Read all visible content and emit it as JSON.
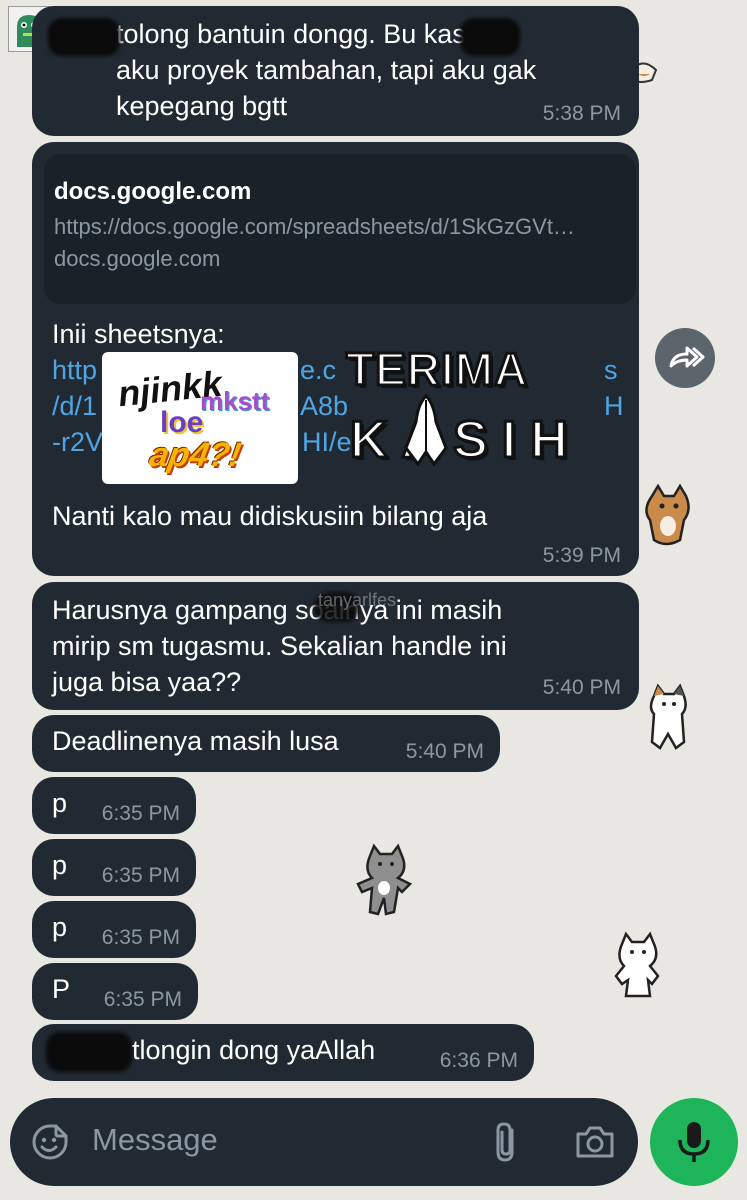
{
  "messages": [
    {
      "text": "tolong bantuin dongg. Bu       kasih\naku proyek tambahan, tapi aku gak\nkepegang bgtt",
      "time": "5:38 PM"
    },
    {
      "text": "Inii sheetsnya:",
      "time": "5:39 PM",
      "link_preview": {
        "site": "docs.google.com",
        "url": "https://docs.google.com/spreadsheets/d/1SkGzGVt…",
        "domain": "docs.google.com"
      },
      "link_fragments": [
        "http",
        "e.c",
        "s",
        "/d/1",
        "A8b",
        "H",
        "-r2V",
        "HI/e"
      ],
      "followup": "Nanti kalo mau didiskusiin bilang aja"
    },
    {
      "text": "Harusnya gampang        soalnya ini masih\nmirip sm tugasmu. Sekalian handle ini\njuga bisa yaa??",
      "time": "5:40 PM"
    },
    {
      "text": "Deadlinenya masih lusa",
      "time": "5:40 PM"
    },
    {
      "text": "p",
      "time": "6:35 PM"
    },
    {
      "text": "p",
      "time": "6:35 PM"
    },
    {
      "text": "p",
      "time": "6:35 PM"
    },
    {
      "text": "P",
      "time": "6:35 PM"
    },
    {
      "text": "tlongin dong yaAllah",
      "time": "6:36 PM"
    }
  ],
  "stickers": {
    "meme": {
      "line1": "njinkk",
      "line2": "mkstt",
      "line3": "loe",
      "line4": "ap4?!"
    },
    "terima_kasih": {
      "line1": "TERIMA",
      "line2": "KASIH"
    }
  },
  "watermark": "tanyarlfes",
  "composer": {
    "placeholder": "Message"
  },
  "icons": {
    "emoji": "emoji-icon",
    "attach": "paperclip-icon",
    "camera": "camera-icon",
    "mic": "microphone-icon",
    "forward": "forward-icon"
  },
  "colors": {
    "background": "#e9e7e1",
    "bubble": "#212a33",
    "link": "#4fa5e4",
    "mic_button": "#1db45a",
    "time": "#8b98a4"
  }
}
